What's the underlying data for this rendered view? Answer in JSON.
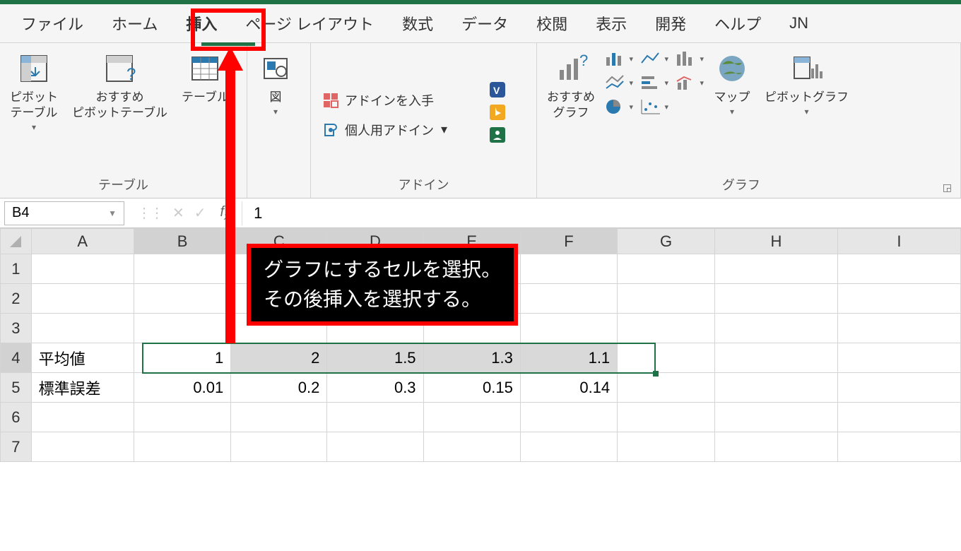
{
  "tabs": {
    "file": "ファイル",
    "home": "ホーム",
    "insert": "挿入",
    "pagelayout": "ページ レイアウト",
    "formulas": "数式",
    "data": "データ",
    "review": "校閲",
    "view": "表示",
    "developer": "開発",
    "help": "ヘルプ",
    "jn": "JN"
  },
  "ribbon": {
    "tables": {
      "pivot": "ピボット\nテーブル",
      "rec_pivot": "おすすめ\nピボットテーブル",
      "table": "テーブル",
      "group": "テーブル"
    },
    "illus": {
      "pictures": "図"
    },
    "addins": {
      "get": "アドインを入手",
      "my": "個人用アドイン",
      "group": "アドイン"
    },
    "charts": {
      "rec": "おすすめ\nグラフ",
      "maps": "マップ",
      "pivotchart": "ピボットグラフ",
      "group": "グラフ"
    }
  },
  "formula_bar": {
    "name_box": "B4",
    "fx": "1"
  },
  "columns": [
    "A",
    "B",
    "C",
    "D",
    "E",
    "F",
    "G",
    "H",
    "I"
  ],
  "rows": [
    "1",
    "2",
    "3",
    "4",
    "5",
    "6",
    "7"
  ],
  "cells": {
    "A4": "平均値",
    "B4": "1",
    "C4": "2",
    "D4": "1.5",
    "E4": "1.3",
    "F4": "1.1",
    "A5": "標準誤差",
    "B5": "0.01",
    "C5": "0.2",
    "D5": "0.3",
    "E5": "0.15",
    "F5": "0.14"
  },
  "annotation": {
    "line1": "グラフにするセルを選択。",
    "line2": "その後挿入を選択する。"
  }
}
